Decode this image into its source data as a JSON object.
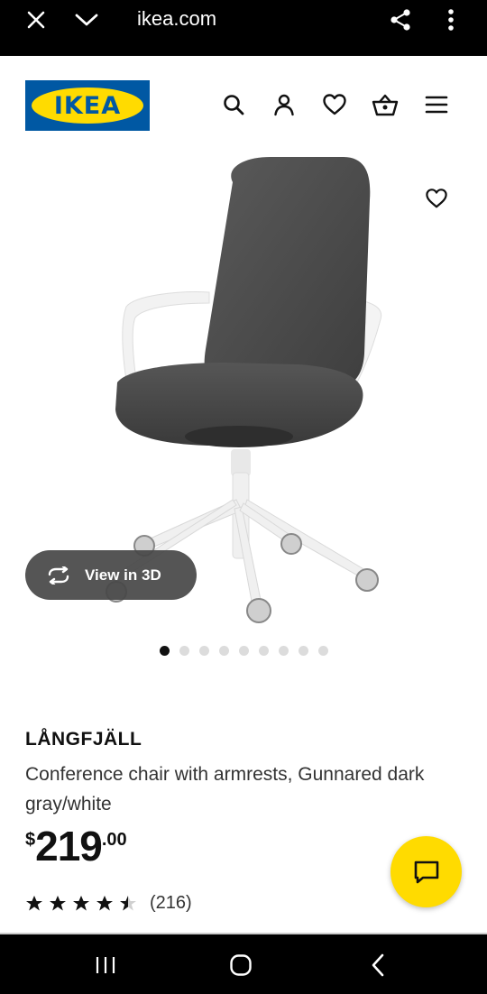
{
  "browser": {
    "url": "ikea.com"
  },
  "header": {
    "logo_text": "IKEA",
    "icons": [
      "search-icon",
      "account-icon",
      "favorites-icon",
      "basket-icon",
      "menu-icon"
    ]
  },
  "product_image": {
    "view_3d_label": "View in 3D",
    "gallery_dot_count": 9,
    "gallery_active_index": 0
  },
  "product": {
    "name": "LÅNGFJÄLL",
    "description": "Conference chair with armrests, Gunnared dark gray/white",
    "price": {
      "currency": "$",
      "integer": "219",
      "decimals": ".00"
    },
    "rating": {
      "stars": 4.5,
      "count": "(216)"
    }
  },
  "colors": {
    "ikea_blue": "#0058a3",
    "ikea_yellow": "#ffdb00",
    "chair_fabric": "#4a4a4a"
  }
}
